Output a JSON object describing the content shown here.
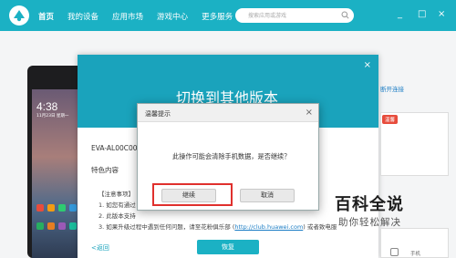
{
  "header": {
    "nav": [
      "首页",
      "我的设备",
      "应用市场",
      "游戏中心",
      "更多服务"
    ],
    "search_placeholder": "搜索应用或游戏",
    "window_controls": [
      "_",
      "□",
      "×"
    ]
  },
  "phone": {
    "time": "4:38",
    "date": "11月23日 星期一"
  },
  "panel": {
    "title": "切换到其他版本",
    "model": "EVA-AL00C00B",
    "features_label": "特色内容",
    "notice_heading": "【注意事项】",
    "notice_lines": [
      "1. 如您有通过",
      "2. 此版本支持",
      "3. 如果升级过程中遇到任何问题，请至花粉俱乐部 (",
      "http://club.huawei.com",
      ") 或者致电服"
    ],
    "back_link": "<返回",
    "restore_button": "恢复"
  },
  "sidebar": {
    "reconnect": "断开连接",
    "badge": "温馨",
    "item_label": "手机"
  },
  "dialog": {
    "title": "温馨提示",
    "message": "此操作可能会清除手机数据，是否继续？",
    "continue_label": "继续",
    "cancel_label": "取消"
  },
  "watermark": {
    "title": "百科全说",
    "subtitle": "助你轻松解决"
  },
  "colors": {
    "accent": "#1bb1c4",
    "panel_head": "#1aa3bc",
    "highlight": "#e0302d"
  }
}
